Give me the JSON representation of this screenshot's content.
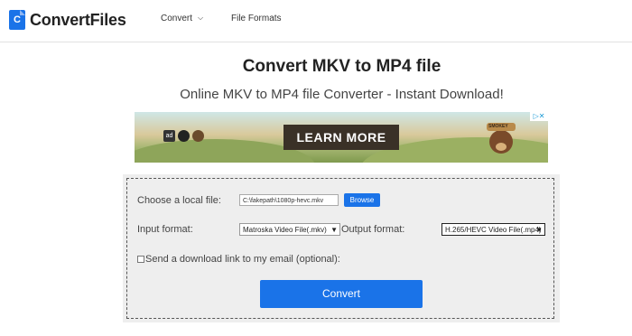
{
  "header": {
    "logo_glyph": "C",
    "brand": "ConvertFiles",
    "nav": [
      {
        "label": "Convert",
        "has_dropdown": true
      },
      {
        "label": "File Formats",
        "has_dropdown": false
      }
    ]
  },
  "page": {
    "title": "Convert MKV to MP4 file",
    "subtitle": "Online MKV to MP4 file Converter - Instant Download!"
  },
  "ad": {
    "cta": "LEARN MORE",
    "mascot_text": "SMOKEY",
    "badge_text": "ad"
  },
  "form": {
    "local_file_label": "Choose a local file:",
    "local_file_value": "C:\\fakepath\\1080p-hevc.mkv",
    "browse_label": "Browse",
    "input_format_label": "Input format:",
    "input_format_value": "Matroska Video File(.mkv)",
    "output_format_label": "Output format:",
    "output_format_value": "H.265/HEVC Video File(.mp4)",
    "email_label": "Send a download link to my email (optional):",
    "email_checked": false,
    "convert_label": "Convert"
  },
  "colors": {
    "accent": "#1a73e8",
    "panel_bg": "#eeeeee"
  }
}
